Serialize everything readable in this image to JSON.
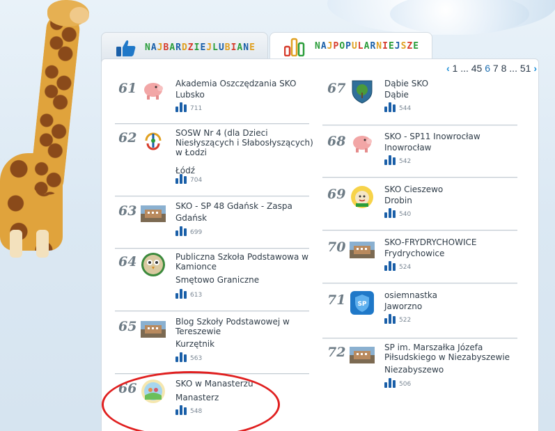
{
  "tabs": {
    "liked_label": "NAJBARDZIEJ LUBIANE",
    "popular_label": "NAJPOPULARNIEJSZE",
    "liked_colors": [
      "#2a9d3a",
      "#1a5fa8",
      "#e0a020",
      "#d63b2b",
      "#2a9d3a",
      "#1a5fa8",
      "#e0a020",
      "#d63b2b",
      "#2a9d3a",
      "#1a5fa8",
      "#e0a020",
      "#d63b2b",
      "#2a9d3a",
      "#1a5fa8",
      "#e0a020",
      "#d63b2b",
      "#2a9d3a",
      "#1a5fa8",
      "#e0a020"
    ],
    "popular_colors": [
      "#2a9d3a",
      "#1a5fa8",
      "#e0a020",
      "#d63b2b",
      "#2a9d3a",
      "#1a5fa8",
      "#e0a020",
      "#d63b2b",
      "#2a9d3a",
      "#1a5fa8",
      "#e0a020",
      "#d63b2b",
      "#2a9d3a",
      "#1a5fa8",
      "#e0a020",
      "#d63b2b",
      "#2a9d3a"
    ]
  },
  "pagination": {
    "prev": "‹",
    "first": "1",
    "ellipsis1": "...",
    "pages": [
      "4",
      "5",
      "6",
      "7",
      "8"
    ],
    "current": "6",
    "ellipsis2": "...",
    "last": "51",
    "next": "›"
  },
  "left_items": [
    {
      "rank": "61",
      "title": "Akademia Oszczędzania SKO",
      "city": "Lubsko",
      "votes": "711",
      "icon": "piggy-bank-logo"
    },
    {
      "rank": "62",
      "title": "SOSW Nr 4 (dla Dzieci Niesłyszących i Słabosłyszących) w Łodzi",
      "city": "Łódź",
      "votes": "704",
      "icon": "colorful-sign-logo"
    },
    {
      "rank": "63",
      "title": "SKO - SP 48 Gdańsk - Zaspa",
      "city": "Gdańsk",
      "votes": "699",
      "icon": "school-photo"
    },
    {
      "rank": "64",
      "title": "Publiczna Szkoła Podstawowa w Kamionce",
      "city": "Smętowo Graniczne",
      "votes": "613",
      "icon": "owl-logo"
    },
    {
      "rank": "65",
      "title": "Blog Szkoły Podstawowej w Tereszewie",
      "city": "Kurzętnik",
      "votes": "563",
      "icon": "school-photo"
    },
    {
      "rank": "66",
      "title": "SKO w Manasterzu",
      "city": "Manasterz",
      "votes": "548",
      "icon": "round-kids-logo"
    }
  ],
  "right_items": [
    {
      "rank": "67",
      "title": "Dąbie SKO",
      "city": "Dąbie",
      "votes": "544",
      "icon": "coat-of-arms"
    },
    {
      "rank": "68",
      "title": "SKO - SP11 Inowrocław",
      "city": "Inowrocław",
      "votes": "542",
      "icon": "piggy-bank-logo"
    },
    {
      "rank": "69",
      "title": "SKO Cieszewo",
      "city": "Drobin",
      "votes": "540",
      "icon": "sun-character-logo"
    },
    {
      "rank": "70",
      "title": "SKO-FRYDRYCHOWICE",
      "city": "Frydrychowice",
      "votes": "524",
      "icon": "school-photo"
    },
    {
      "rank": "71",
      "title": "osiemnastka",
      "city": "Jaworzno",
      "votes": "522",
      "icon": "sp-shield-logo"
    },
    {
      "rank": "72",
      "title": "SP im. Marszałka Józefa Piłsudskiego w Niezabyszewie",
      "city": "Niezabyszewo",
      "votes": "506",
      "icon": "school-photo"
    }
  ],
  "colors": {
    "accent_blue": "#1a5fa8",
    "rank_gray": "#6d7b85",
    "highlight_red": "#e02020"
  }
}
